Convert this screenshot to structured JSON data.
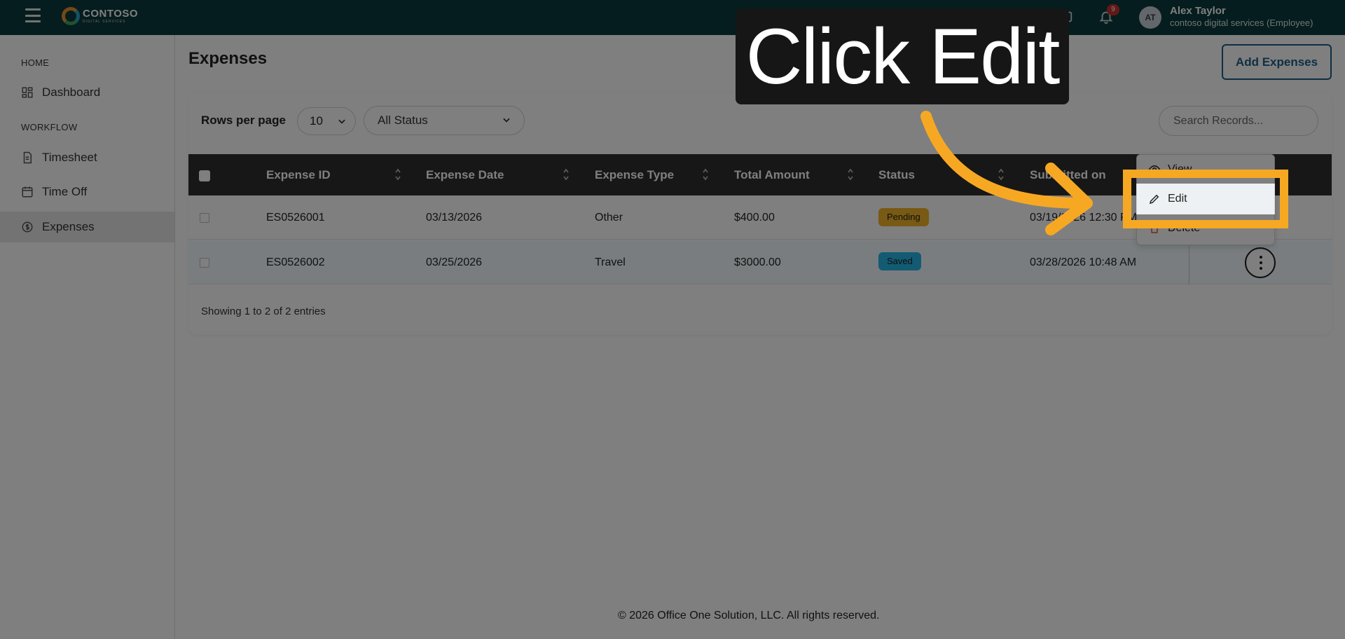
{
  "app": {
    "logo_name": "CONTOSO",
    "logo_sub": "DIGITAL SERVICES",
    "notification_count": "9",
    "user": {
      "initials": "AT",
      "name": "Alex Taylor",
      "org": "contoso digital services (Employee)"
    }
  },
  "sidebar": {
    "home_heading": "HOME",
    "workflow_heading": "WORKFLOW",
    "items": [
      {
        "label": "Dashboard",
        "icon": "dashboard-icon"
      },
      {
        "label": "Timesheet",
        "icon": "timesheet-icon"
      },
      {
        "label": "Time Off",
        "icon": "calendar-icon"
      },
      {
        "label": "Expenses",
        "icon": "dollar-icon",
        "active": true
      }
    ]
  },
  "main": {
    "title": "Expenses",
    "add_button": "Add Expenses",
    "rows_per_page_label": "Rows per page",
    "rows_per_page_value": "10",
    "status_filter_value": "All Status",
    "search_placeholder": "Search Records...",
    "columns": [
      "Expense ID",
      "Expense Date",
      "Expense Type",
      "Total Amount",
      "Status",
      "Submitted on"
    ],
    "rows": [
      {
        "id": "ES0526001",
        "date": "03/13/2026",
        "type": "Other",
        "amount": "$400.00",
        "status": "Pending",
        "submitted": "03/19/2026 12:30 PM"
      },
      {
        "id": "ES0526002",
        "date": "03/25/2026",
        "type": "Travel",
        "amount": "$3000.00",
        "status": "Saved",
        "submitted": "03/28/2026 10:48 AM"
      }
    ],
    "showing_text": "Showing 1 to 2 of 2 entries"
  },
  "action_menu": {
    "view": "View",
    "edit": "Edit",
    "delete": "Delete"
  },
  "overlay": {
    "callout": "Click Edit",
    "accent_color": "#f7a823"
  },
  "footer": "© 2026 Office One Solution, LLC. All rights reserved.",
  "colors": {
    "topbar": "#0b3b3c",
    "pending": "#f0b429",
    "saved": "#27b7e7",
    "primary": "#1f5f86"
  }
}
